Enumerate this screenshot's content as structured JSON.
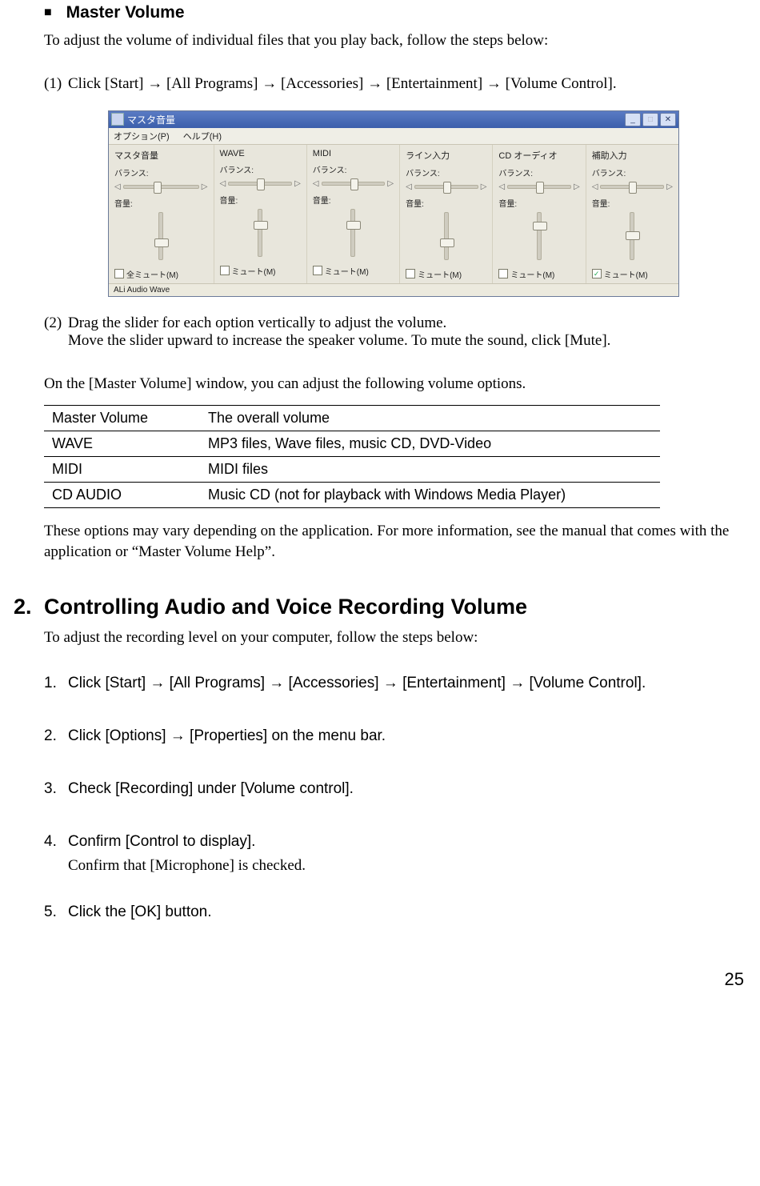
{
  "section1": {
    "title": "Master Volume",
    "intro": "To adjust the volume of individual files that you play back, follow the steps below:",
    "step1": "Click [Start] → [All Programs] → [Accessories] → [Entertainment] → [Volume Control].",
    "step2a": "Drag the slider for each option vertically to adjust the volume.",
    "step2b": "Move the slider upward to increase the speaker volume. To mute the sound, click [Mute].",
    "lead2": "On the [Master Volume] window, you can adjust the following volume options.",
    "note": "These options may vary depending on the application. For more information, see the manual that comes with the application or “Master Volume Help”."
  },
  "vc": {
    "title": "マスタ音量",
    "menu_options": "オプション(P)",
    "menu_help": "ヘルプ(H)",
    "balance": "バランス:",
    "volume": "音量:",
    "mute_all": "全ミュート(M)",
    "mute": "ミュート(M)",
    "status": "ALi Audio Wave",
    "channels": [
      {
        "name": "マスタ音量",
        "bal": 40,
        "vol": 55,
        "checked": false
      },
      {
        "name": "WAVE",
        "bal": 45,
        "vol": 25,
        "checked": false
      },
      {
        "name": "MIDI",
        "bal": 45,
        "vol": 25,
        "checked": false
      },
      {
        "name": "ライン入力",
        "bal": 45,
        "vol": 55,
        "checked": false
      },
      {
        "name": "CD オーディオ",
        "bal": 45,
        "vol": 20,
        "checked": false
      },
      {
        "name": "補助入力",
        "bal": 45,
        "vol": 40,
        "checked": true
      }
    ]
  },
  "table": {
    "rows": [
      {
        "k": "Master Volume",
        "v": "The overall volume"
      },
      {
        "k": "WAVE",
        "v": "MP3 files, Wave files, music CD, DVD-Video"
      },
      {
        "k": "MIDI",
        "v": "MIDI files"
      },
      {
        "k": "CD AUDIO",
        "v": "Music CD (not for playback with Windows Media Player)"
      }
    ]
  },
  "section2": {
    "num": "2.",
    "title": "Controlling Audio and Voice Recording Volume",
    "intro": "To adjust the recording level on your computer, follow the steps below:",
    "s1": "Click [Start] → [All Programs] → [Accessories] → [Entertainment] → [Volume Control].",
    "s2": "Click [Options] → [Properties] on the menu bar.",
    "s3": "Check [Recording] under [Volume control].",
    "s4": "Confirm [Control to display].",
    "s4b": "Confirm that [Microphone] is checked.",
    "s5": "Click the [OK] button."
  },
  "page": "25"
}
